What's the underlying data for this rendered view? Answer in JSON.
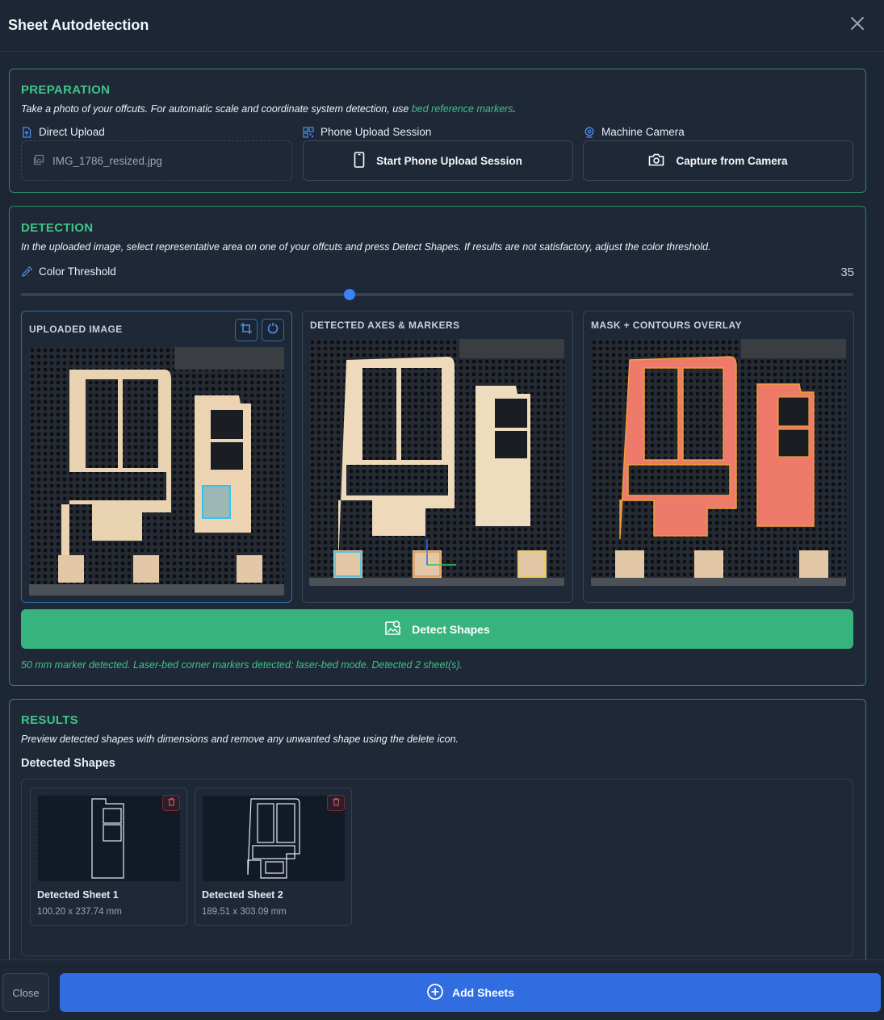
{
  "dialog": {
    "title": "Sheet Autodetection"
  },
  "preparation": {
    "title": "PREPARATION",
    "desc_prefix": "Take a photo of your offcuts. For automatic scale and coordinate system detection, use ",
    "desc_link": "bed reference markers",
    "desc_suffix": ".",
    "direct_upload_label": "Direct Upload",
    "uploaded_file": "IMG_1786_resized.jpg",
    "phone_label": "Phone Upload Session",
    "phone_button": "Start Phone Upload Session",
    "camera_label": "Machine Camera",
    "camera_button": "Capture from Camera"
  },
  "detection": {
    "title": "DETECTION",
    "desc": "In the uploaded image, select representative area on one of your offcuts and press Detect Shapes. If results are not satisfactory, adjust the color threshold.",
    "threshold_label": "Color Threshold",
    "threshold_value": "35",
    "threshold_fraction": 0.395,
    "panels": {
      "uploaded": "UPLOADED IMAGE",
      "axes": "DETECTED AXES & MARKERS",
      "mask": "MASK + CONTOURS OVERLAY"
    },
    "detect_button": "Detect Shapes",
    "status": "50 mm marker detected. Laser-bed corner markers detected: laser-bed mode. Detected 2 sheet(s)."
  },
  "results": {
    "title": "RESULTS",
    "desc": "Preview detected shapes with dimensions and remove any unwanted shape using the delete icon.",
    "subtitle": "Detected Shapes",
    "shapes": [
      {
        "name": "Detected Sheet 1",
        "dims": "100.20 x 237.74 mm"
      },
      {
        "name": "Detected Sheet 2",
        "dims": "189.51 x 303.09 mm"
      }
    ]
  },
  "footer": {
    "close": "Close",
    "add": "Add Sheets"
  },
  "colors": {
    "accent_green": "#3fc487",
    "button_green": "#37b37e",
    "primary_blue": "#2f6de1",
    "background": "#1d2634"
  }
}
